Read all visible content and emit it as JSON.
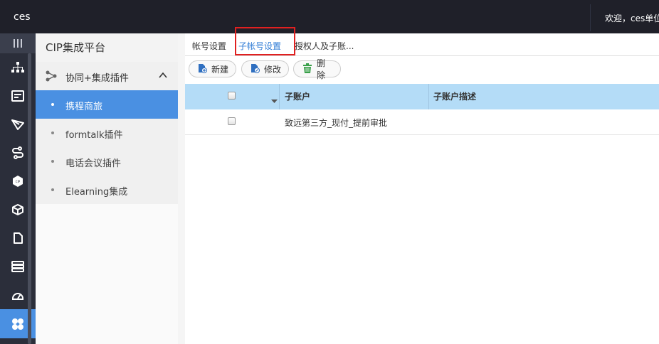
{
  "header": {
    "brand": "ces",
    "welcome": "欢迎，ces单位"
  },
  "rail": {
    "icons": [
      "menu-icon",
      "org-chart-icon",
      "form-icon",
      "send-icon",
      "workflow-icon",
      "cip-icon",
      "cube-icon",
      "document-icon",
      "database-icon",
      "gauge-icon",
      "plugin-icon"
    ],
    "active": "plugin-icon"
  },
  "sidebar": {
    "title": "CIP集成平台",
    "group": {
      "label": "协同+集成插件",
      "expanded": true
    },
    "items": [
      {
        "label": "携程商旅",
        "active": true
      },
      {
        "label": "formtalk插件",
        "active": false
      },
      {
        "label": "电话会议插件",
        "active": false
      },
      {
        "label": "Elearning集成",
        "active": false
      }
    ]
  },
  "tabs": [
    {
      "label": "帐号设置"
    },
    {
      "label": "子帐号设置"
    },
    {
      "label": "授权人及子账..."
    }
  ],
  "toolbar": {
    "new_label": "新建",
    "edit_label": "修改",
    "delete_label": "删除"
  },
  "grid": {
    "columns": [
      "子账户",
      "子账户描述"
    ],
    "rows": [
      {
        "account": "致远第三方_现付_提前审批",
        "description": ""
      }
    ]
  },
  "colors": {
    "accent": "#4a90e2",
    "topbar": "#1f2029",
    "rail": "#2b2e3a",
    "grid_header": "#b4dcf7",
    "highlight": "#e02020"
  }
}
